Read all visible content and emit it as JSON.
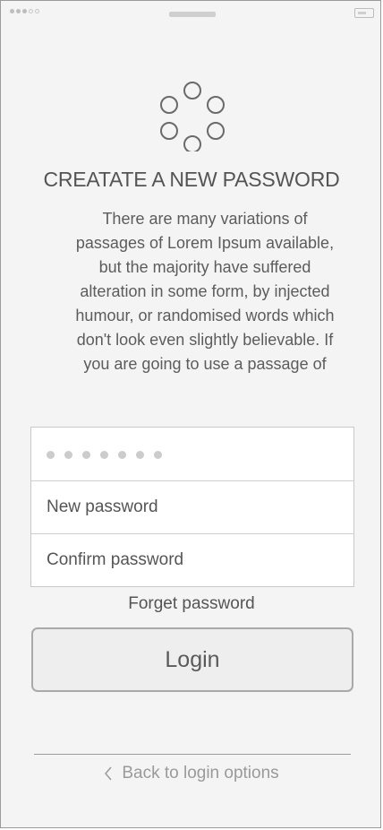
{
  "status_bar": {
    "signal_dots": 5,
    "signal_filled": 3
  },
  "header": {
    "loader_icon": "loading-spinner-icon",
    "title": "CREATATE A NEW PASSWORD",
    "description": "There are many variations of passages of Lorem Ipsum available, but the majority have suffered alteration in some form, by injected humour, or randomised words which don't look even slightly believable. If you are going to use a passage of"
  },
  "form": {
    "current_password_mask_count": 7,
    "new_password_placeholder": "New password",
    "confirm_password_placeholder": "Confirm password",
    "forget_label": "Forget password",
    "login_label": "Login"
  },
  "footer": {
    "back_label": "Back to login options",
    "back_icon": "chevron-left-icon"
  },
  "colors": {
    "background": "#f4f4f4",
    "border": "#c8c8c8",
    "text": "#555555",
    "muted_text": "#9a9a9a"
  }
}
